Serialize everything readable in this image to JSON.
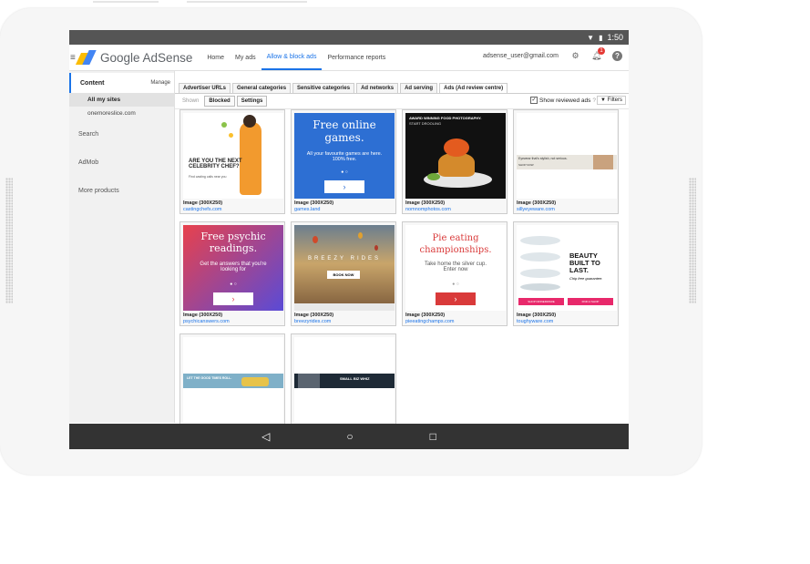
{
  "status_bar": {
    "time": "1:50",
    "icons": [
      "wifi-icon",
      "battery-icon"
    ]
  },
  "app": {
    "logo_text": "Google AdSense"
  },
  "nav": {
    "tabs": [
      "Home",
      "My ads",
      "Allow & block ads",
      "Performance reports"
    ],
    "active_index": 2
  },
  "account": {
    "email": "adsense_user@gmail.com",
    "notification_count": "1"
  },
  "sidebar": {
    "content_label": "Content",
    "manage_label": "Manage",
    "items": [
      "All my sites",
      "onemoreslice.com"
    ],
    "sections": [
      "Search",
      "AdMob",
      "More products"
    ]
  },
  "filter_tabs": [
    "Advertiser URLs",
    "General categories",
    "Sensitive categories",
    "Ad networks",
    "Ad serving",
    "Ads (Ad review centre)"
  ],
  "sub_tabs": [
    "Shown",
    "Blocked",
    "Settings"
  ],
  "show_reviewed_label": "Show reviewed ads",
  "filters_label": "Filters",
  "ads": [
    {
      "size": "Image (300X250)",
      "domain": "castingchefs.com",
      "headline": "ARE YOU THE NEXT CELEBRITY CHEF?",
      "sub": "Find casting calls near you"
    },
    {
      "size": "Image (300X250)",
      "domain": "games.land",
      "headline": "Free online games.",
      "sub": "All your favourite games are here. 100% free."
    },
    {
      "size": "Image (300X250)",
      "domain": "nomnomphotos.com",
      "headline": "AWARD WINNING FOOD PHOTOGRAPHY.",
      "sub": "START DROOLING"
    },
    {
      "size": "Image (300X250)",
      "domain": "sillyeyeware.com",
      "headline": "Eyewear that's stylish, not serious.",
      "sub": "SHOP NOW"
    },
    {
      "size": "Image (300X250)",
      "domain": "psychicanswers.com",
      "headline": "Free psychic readings.",
      "sub": "Get the answers that you're looking for"
    },
    {
      "size": "Image (300X250)",
      "domain": "breezyrides.com",
      "headline": "BREEZY RIDES",
      "sub": "BOOK NOW"
    },
    {
      "size": "Image (300X250)",
      "domain": "pieeatingchamps.com",
      "headline": "Pie eating championships.",
      "sub": "Take home the silver cup. Enter now"
    },
    {
      "size": "Image (300X250)",
      "domain": "toughyware.com",
      "headline": "BEAUTY BUILT TO LAST.",
      "sub": "Chip free guarantee.",
      "buttons": [
        "SHOP DINNERWARE",
        "FIND A SHOP"
      ]
    },
    {
      "headline": "LET THE GOOD TIMES ROLL."
    },
    {
      "headline": "SMALL BIZ WHIZ"
    }
  ],
  "colors": {
    "accent": "#1a73e8",
    "games_bg": "#2d6fd3",
    "pie_btn": "#d93a3a",
    "psychic_from": "#e8414c",
    "psychic_to": "#5a4bd6",
    "plates_pink": "#e8296b"
  }
}
